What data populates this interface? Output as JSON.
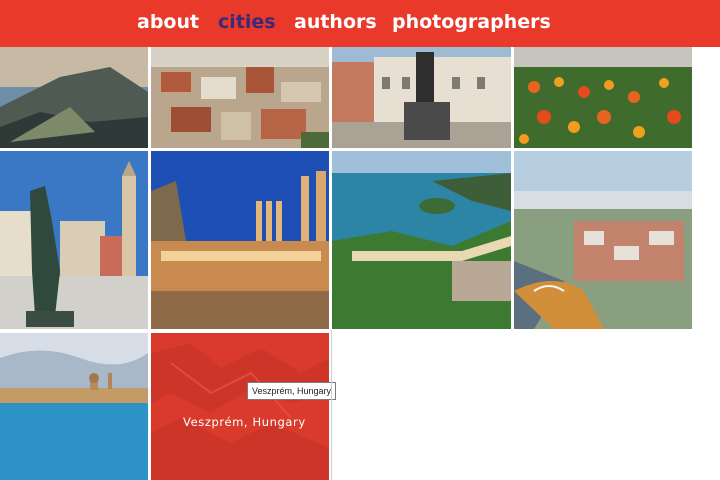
{
  "nav": {
    "items": [
      {
        "label": "about",
        "active": false
      },
      {
        "label": "cities",
        "active": true
      },
      {
        "label": "authors",
        "active": false
      },
      {
        "label": "photographers",
        "active": false
      }
    ]
  },
  "gallery": {
    "hover_tile": {
      "caption": "Veszprém, Hungary",
      "tooltip": "Veszprém, Hungary"
    }
  },
  "colors": {
    "brand_red": "#e8392b",
    "active_nav": "#3b2a7a"
  }
}
